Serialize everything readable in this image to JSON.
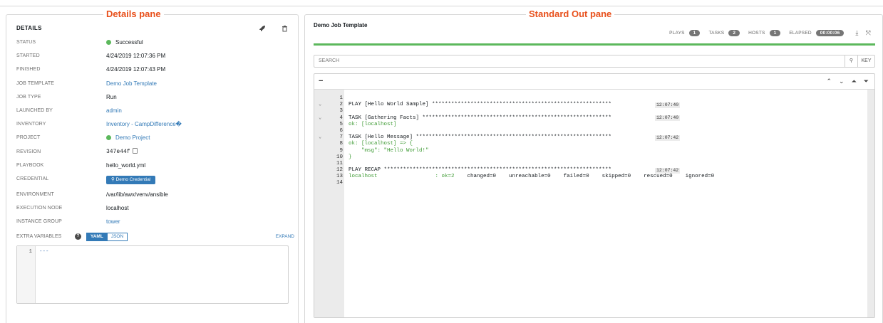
{
  "details": {
    "caption": "Details pane",
    "title": "DETAILS",
    "launch_icon": "rocket-icon",
    "delete_icon": "trash-icon",
    "rows": [
      {
        "label": "STATUS",
        "value": "Successful"
      },
      {
        "label": "STARTED",
        "value": "4/24/2019 12:07:36 PM"
      },
      {
        "label": "FINISHED",
        "value": "4/24/2019 12:07:43 PM"
      },
      {
        "label": "JOB TEMPLATE",
        "value": "Demo Job Template"
      },
      {
        "label": "JOB TYPE",
        "value": "Run"
      },
      {
        "label": "LAUNCHED BY",
        "value": "admin"
      },
      {
        "label": "INVENTORY",
        "value": "Inventory - CampDifference�"
      },
      {
        "label": "PROJECT",
        "value": "Demo Project"
      },
      {
        "label": "REVISION",
        "value": "347e44f"
      },
      {
        "label": "PLAYBOOK",
        "value": "hello_world.yml"
      },
      {
        "label": "CREDENTIAL",
        "value": "Demo Credential"
      },
      {
        "label": "ENVIRONMENT",
        "value": "/var/lib/awx/venv/ansible"
      },
      {
        "label": "EXECUTION NODE",
        "value": "localhost"
      },
      {
        "label": "INSTANCE GROUP",
        "value": "tower"
      }
    ],
    "extra_vars": {
      "label": "EXTRA VARIABLES",
      "yaml": "YAML",
      "json": "JSON",
      "expand": "EXPAND",
      "line_number": "1",
      "content": "---"
    }
  },
  "stdout": {
    "caption": "Standard Out pane",
    "job_title": "Demo Job Template",
    "counts": {
      "plays_label": "PLAYS",
      "plays": "1",
      "tasks_label": "TASKS",
      "tasks": "2",
      "hosts_label": "HOSTS",
      "hosts": "1",
      "elapsed_label": "ELAPSED",
      "elapsed": "00:00:06"
    },
    "progress": 1.0,
    "search_placeholder": "SEARCH",
    "key_label": "KEY",
    "collapse": "−",
    "lines": [
      {
        "n": "1",
        "text": "",
        "chev": false,
        "ok": false,
        "time": ""
      },
      {
        "n": "2",
        "text": "PLAY [Hello World Sample] ********************************************************",
        "chev": true,
        "ok": false,
        "time": "12:07:40"
      },
      {
        "n": "3",
        "text": "",
        "chev": false,
        "ok": false,
        "time": ""
      },
      {
        "n": "4",
        "text": "TASK [Gathering Facts] ***********************************************************",
        "chev": true,
        "ok": false,
        "time": "12:07:40"
      },
      {
        "n": "5",
        "text": "ok: [localhost]",
        "chev": false,
        "ok": true,
        "time": ""
      },
      {
        "n": "6",
        "text": "",
        "chev": false,
        "ok": false,
        "time": ""
      },
      {
        "n": "7",
        "text": "TASK [Hello Message] *************************************************************",
        "chev": true,
        "ok": false,
        "time": "12:07:42"
      },
      {
        "n": "8",
        "text": "ok: [localhost] => {",
        "chev": false,
        "ok": true,
        "time": ""
      },
      {
        "n": "9",
        "text": "    \"msg\": \"Hello World!\"",
        "chev": false,
        "ok": true,
        "time": ""
      },
      {
        "n": "10",
        "text": "}",
        "chev": false,
        "ok": true,
        "time": ""
      },
      {
        "n": "11",
        "text": "",
        "chev": false,
        "ok": false,
        "time": ""
      },
      {
        "n": "12",
        "text": "PLAY RECAP ***********************************************************************",
        "chev": false,
        "ok": false,
        "time": "12:07:42"
      },
      {
        "n": "13",
        "text": "",
        "chev": false,
        "ok": false,
        "time": "",
        "recap": true
      },
      {
        "n": "14",
        "text": "",
        "chev": false,
        "ok": false,
        "time": ""
      }
    ],
    "recap": {
      "host": "localhost",
      "ok": ": ok=2",
      "rest": "    changed=0    unreachable=0    failed=0    skipped=0    rescued=0    ignored=0"
    }
  }
}
